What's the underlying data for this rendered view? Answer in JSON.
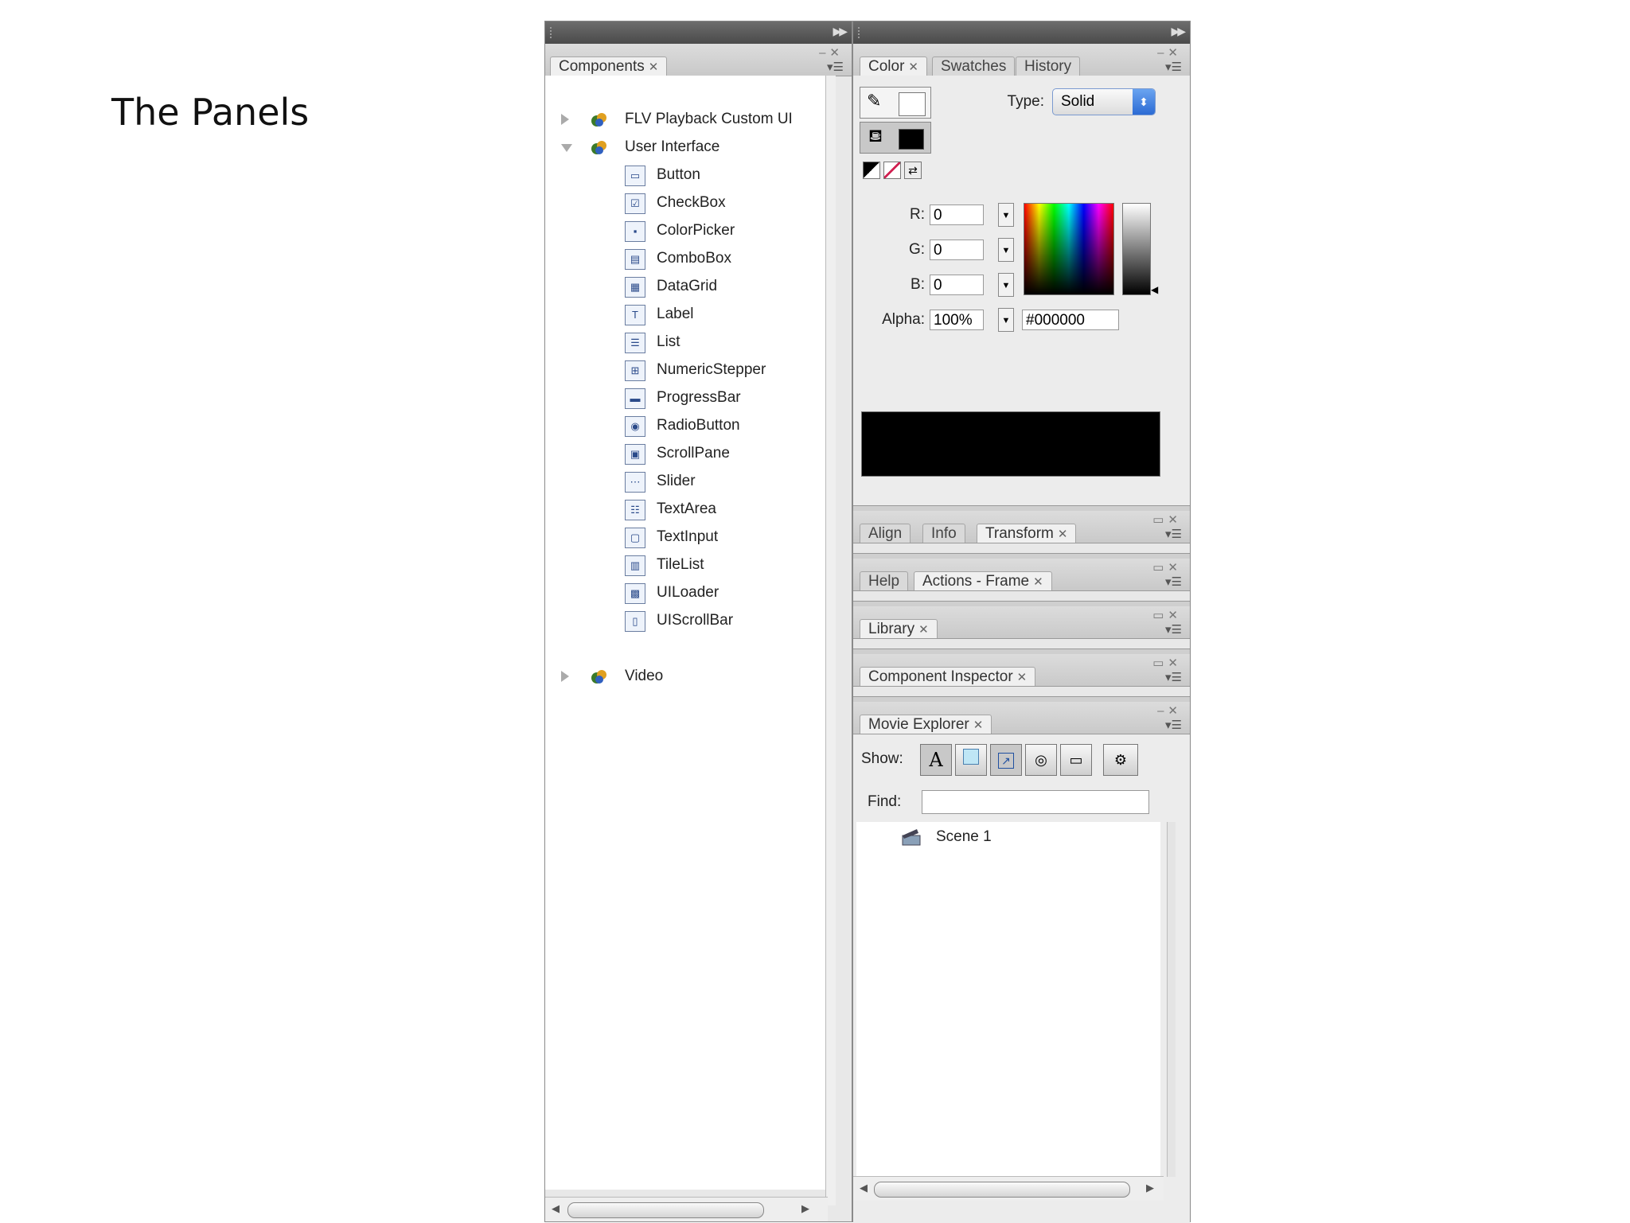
{
  "slide": {
    "title": "The Panels"
  },
  "components_panel": {
    "tab_label": "Components",
    "tree": [
      {
        "label": "FLV Playback Custom UI",
        "expanded": false,
        "icon": "package-icon"
      },
      {
        "label": "User Interface",
        "expanded": true,
        "icon": "package-icon"
      },
      {
        "label": "Video",
        "expanded": false,
        "icon": "package-icon"
      }
    ],
    "ui_items": [
      {
        "label": "Button",
        "icon": "button-icon"
      },
      {
        "label": "CheckBox",
        "icon": "checkbox-icon"
      },
      {
        "label": "ColorPicker",
        "icon": "colorpicker-icon"
      },
      {
        "label": "ComboBox",
        "icon": "combobox-icon"
      },
      {
        "label": "DataGrid",
        "icon": "datagrid-icon"
      },
      {
        "label": "Label",
        "icon": "label-icon"
      },
      {
        "label": "List",
        "icon": "list-icon"
      },
      {
        "label": "NumericStepper",
        "icon": "numericstepper-icon"
      },
      {
        "label": "ProgressBar",
        "icon": "progressbar-icon"
      },
      {
        "label": "RadioButton",
        "icon": "radiobutton-icon"
      },
      {
        "label": "ScrollPane",
        "icon": "scrollpane-icon"
      },
      {
        "label": "Slider",
        "icon": "slider-icon"
      },
      {
        "label": "TextArea",
        "icon": "textarea-icon"
      },
      {
        "label": "TextInput",
        "icon": "textinput-icon"
      },
      {
        "label": "TileList",
        "icon": "tilelist-icon"
      },
      {
        "label": "UILoader",
        "icon": "uiloader-icon"
      },
      {
        "label": "UIScrollBar",
        "icon": "uiscrollbar-icon"
      }
    ]
  },
  "color_panel": {
    "tabs": [
      "Color",
      "Swatches",
      "History"
    ],
    "type_label": "Type:",
    "type_value": "Solid",
    "r_label": "R:",
    "r_value": "0",
    "g_label": "G:",
    "g_value": "0",
    "b_label": "B:",
    "b_value": "0",
    "alpha_label": "Alpha:",
    "alpha_value": "100%",
    "hex_value": "#000000",
    "preview_color": "#000000"
  },
  "collapsed_panels": [
    {
      "tabs": [
        "Align",
        "Info",
        "Transform"
      ]
    },
    {
      "tabs": [
        "Help",
        "Actions - Frame"
      ]
    },
    {
      "tabs": [
        "Library"
      ]
    },
    {
      "tabs": [
        "Component Inspector"
      ]
    }
  ],
  "movie_explorer": {
    "tab_label": "Movie Explorer",
    "show_label": "Show:",
    "find_label": "Find:",
    "find_value": "",
    "show_buttons": [
      "text-icon",
      "symbol-icon",
      "actionscript-icon",
      "video-sound-icon",
      "frames-icon",
      "customize-icon"
    ],
    "scene_label": "Scene 1"
  },
  "icons": {
    "close": "close-icon",
    "menu": "panel-menu-icon",
    "collapse": "collapse-arrows-icon"
  }
}
